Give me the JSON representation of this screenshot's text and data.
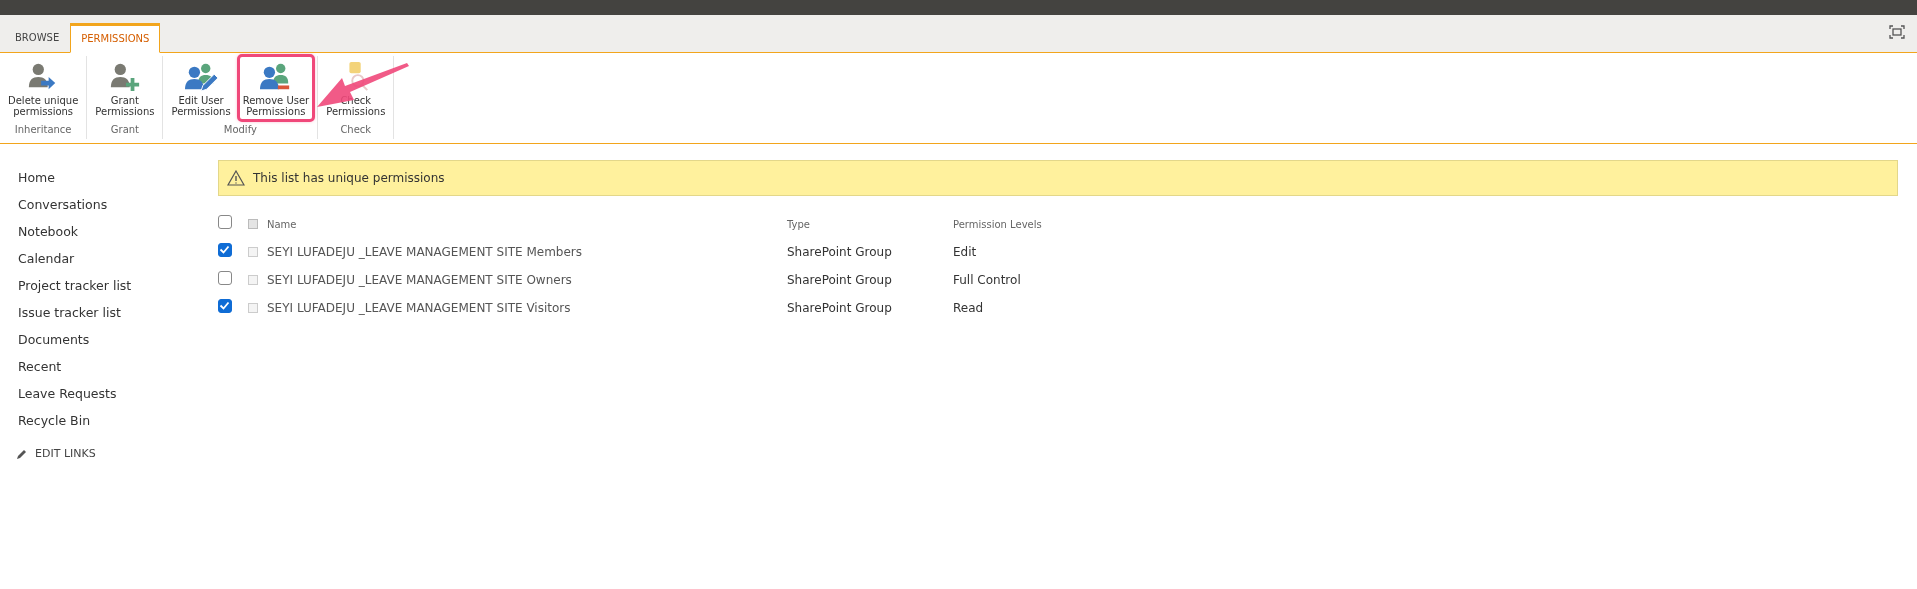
{
  "tabs": [
    {
      "label": "BROWSE",
      "selected": false
    },
    {
      "label": "PERMISSIONS",
      "selected": true
    }
  ],
  "ribbon_groups": [
    {
      "label": "Inheritance",
      "buttons": [
        {
          "kind": "delete",
          "lines": [
            "Delete unique",
            "permissions"
          ],
          "highlighted": false,
          "disabled": false
        }
      ]
    },
    {
      "label": "Grant",
      "buttons": [
        {
          "kind": "grant",
          "lines": [
            "Grant",
            "Permissions"
          ],
          "highlighted": false,
          "disabled": false
        }
      ]
    },
    {
      "label": "Modify",
      "buttons": [
        {
          "kind": "edit",
          "lines": [
            "Edit User",
            "Permissions"
          ],
          "highlighted": false,
          "disabled": false
        },
        {
          "kind": "remove",
          "lines": [
            "Remove User",
            "Permissions"
          ],
          "highlighted": true,
          "disabled": false
        }
      ]
    },
    {
      "label": "Check",
      "buttons": [
        {
          "kind": "check",
          "lines": [
            "Check",
            "Permissions"
          ],
          "highlighted": false,
          "disabled": false
        }
      ]
    }
  ],
  "sidebar": {
    "items": [
      "Home",
      "Conversations",
      "Notebook",
      "Calendar",
      "Project tracker list",
      "Issue tracker list",
      "Documents",
      "Recent",
      "Leave Requests",
      "Recycle Bin"
    ],
    "edit_links": "EDIT LINKS"
  },
  "notice": "This list has unique permissions",
  "table": {
    "select_all_checked": false,
    "header_box_disabled": true,
    "columns": [
      "Name",
      "Type",
      "Permission Levels"
    ],
    "rows": [
      {
        "name": "SEYI LUFADEJU _LEAVE MANAGEMENT SITE Members",
        "type": "SharePoint Group",
        "level": "Edit",
        "checked": true,
        "selected": false
      },
      {
        "name": "SEYI LUFADEJU _LEAVE MANAGEMENT SITE Owners",
        "type": "SharePoint Group",
        "level": "Full Control",
        "checked": false,
        "selected": false
      },
      {
        "name": "SEYI LUFADEJU _LEAVE MANAGEMENT SITE Visitors",
        "type": "SharePoint Group",
        "level": "Read",
        "checked": true,
        "selected": false
      }
    ]
  }
}
